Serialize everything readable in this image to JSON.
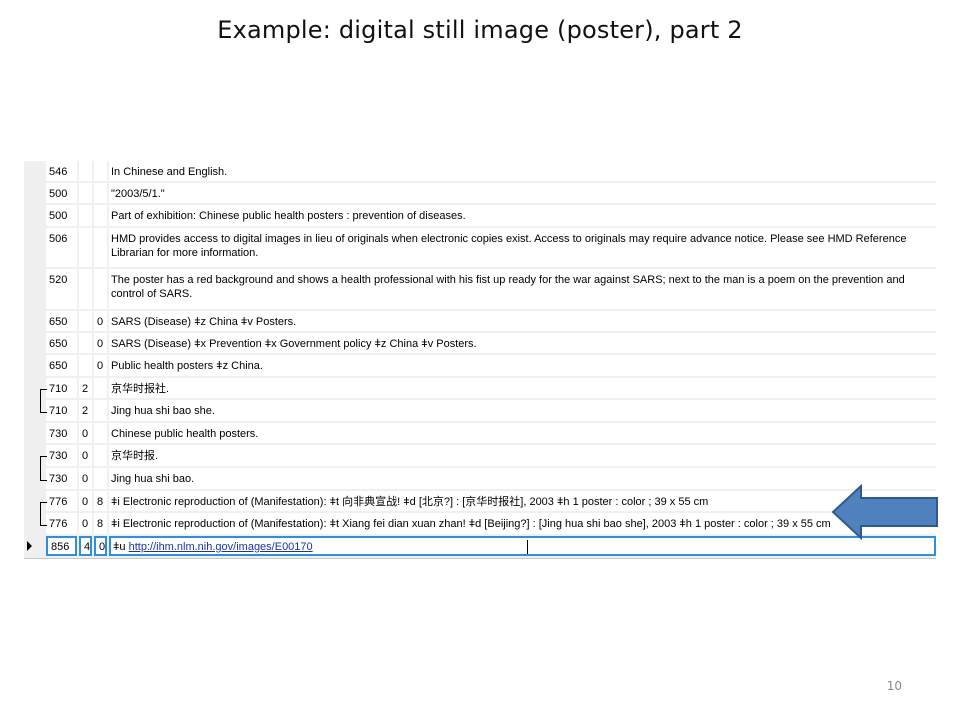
{
  "slide": {
    "title": "Example: digital still image (poster), part 2",
    "number": "10"
  },
  "rows": [
    {
      "tag": "546",
      "ind1": "",
      "ind2": "",
      "text": "In Chinese and English."
    },
    {
      "tag": "500",
      "ind1": "",
      "ind2": "",
      "text": "\"2003/5/1.\""
    },
    {
      "tag": "500",
      "ind1": "",
      "ind2": "",
      "text": "Part of exhibition: Chinese public health posters : prevention of diseases."
    },
    {
      "tag": "506",
      "ind1": "",
      "ind2": "",
      "text": "HMD provides access to digital images in lieu of originals when electronic copies exist.  Access to originals may require advance notice.  Please see HMD Reference Librarian for more information."
    },
    {
      "tag": "520",
      "ind1": "",
      "ind2": "",
      "text": "The poster has a red background and shows a health professional with his fist up ready for the war against SARS; next to the man is a poem on the prevention and control of SARS."
    },
    {
      "tag": "650",
      "ind1": "",
      "ind2": "0",
      "text": "SARS (Disease) ǂz China ǂv Posters."
    },
    {
      "tag": "650",
      "ind1": "",
      "ind2": "0",
      "text": "SARS (Disease) ǂx Prevention ǂx Government policy ǂz China ǂv Posters."
    },
    {
      "tag": "650",
      "ind1": "",
      "ind2": "0",
      "text": "Public health posters ǂz China."
    },
    {
      "tag": "710",
      "ind1": "2",
      "ind2": "",
      "text": "京华时报社."
    },
    {
      "tag": "710",
      "ind1": "2",
      "ind2": "",
      "text": "Jing hua shi bao she."
    },
    {
      "tag": "730",
      "ind1": "0",
      "ind2": "",
      "text": "Chinese public health posters."
    },
    {
      "tag": "730",
      "ind1": "0",
      "ind2": "",
      "text": "京华时报."
    },
    {
      "tag": "730",
      "ind1": "0",
      "ind2": "",
      "text": "Jing hua shi bao."
    },
    {
      "tag": "776",
      "ind1": "0",
      "ind2": "8",
      "text": "ǂi Electronic reproduction of (Manifestation): ǂt 向非典宣战! ǂd [北京?] : [京华时报社], 2003 ǂh 1 poster : color ; 39 x 55 cm"
    },
    {
      "tag": "776",
      "ind1": "0",
      "ind2": "8",
      "text": "ǂi Electronic reproduction of (Manifestation): ǂt Xiang fei dian xuan zhan! ǂd [Beijing?] : [Jing hua shi bao she], 2003 ǂh 1 poster : color ; 39 x 55 cm"
    }
  ],
  "selected_row": {
    "tag": "856",
    "ind1": "4",
    "ind2": "0",
    "prefix": "ǂu ",
    "link": "http://ihm.nlm.nih.gov/images/E00170"
  },
  "colors": {
    "callout_arrow_fill": "#4f81bd",
    "callout_arrow_stroke": "#2f5a8f",
    "selection_border": "#2f8fdc"
  },
  "icons": {
    "row_selector": "right-triangle",
    "callout": "left-arrow"
  }
}
